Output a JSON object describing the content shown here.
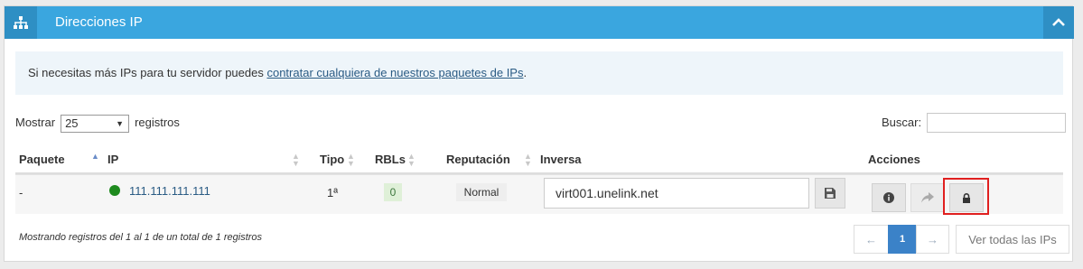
{
  "panel": {
    "title": "Direcciones IP",
    "icon": "network-icon",
    "toggle_icon": "chevron-up-icon"
  },
  "notice": {
    "text_before": "Si necesitas más IPs para tu servidor puedes ",
    "link_text": "contratar cualquiera de nuestros paquetes de IPs",
    "text_after": "."
  },
  "length": {
    "prefix": "Mostrar",
    "value": "25",
    "suffix": "registros"
  },
  "search": {
    "label": "Buscar:",
    "value": ""
  },
  "table": {
    "headers": [
      "Paquete",
      "IP",
      "Tipo",
      "RBLs",
      "Reputación",
      "Inversa",
      "Acciones"
    ],
    "rows": [
      {
        "paquete": "-",
        "status_color": "#1e8a1e",
        "ip": "111.111.111.111",
        "tipo": "1ª",
        "rbls": "0",
        "reputacion": "Normal",
        "inversa": "virt001.unelink.net"
      }
    ]
  },
  "actions": {
    "save_icon": "floppy-disk-icon",
    "info_icon": "info-icon",
    "forward_icon": "share-arrow-icon",
    "lock_icon": "lock-icon"
  },
  "footer": {
    "info": "Mostrando registros del 1 al 1 de un total de 1 registros",
    "prev": "←",
    "page": "1",
    "next": "→",
    "view_all": "Ver todas las IPs"
  },
  "colors": {
    "header": "#3aa6df",
    "header_dark": "#2e8fc4",
    "highlight": "#e02020",
    "page_active": "#3b82c8"
  }
}
